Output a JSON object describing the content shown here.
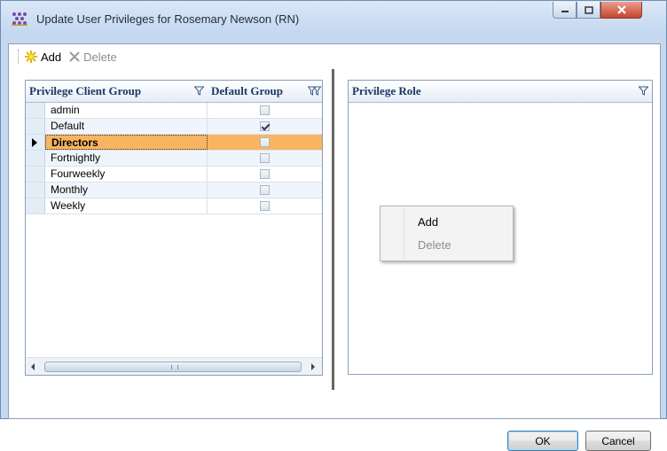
{
  "window": {
    "title": "Update User Privileges for Rosemary Newson (RN)"
  },
  "toolbar": {
    "add_label": "Add",
    "delete_label": "Delete"
  },
  "left_grid": {
    "columns": [
      "Privilege Client Group",
      "Default Group"
    ],
    "rows": [
      {
        "name": "admin",
        "default": false
      },
      {
        "name": "Default",
        "default": true
      },
      {
        "name": "Directors",
        "default": false,
        "selected": true
      },
      {
        "name": "Fortnightly",
        "default": false
      },
      {
        "name": "Fourweekly",
        "default": false
      },
      {
        "name": "Monthly",
        "default": false
      },
      {
        "name": "Weekly",
        "default": false
      }
    ]
  },
  "right_grid": {
    "columns": [
      "Privilege Role"
    ]
  },
  "context_menu": {
    "items": [
      {
        "label": "Add",
        "enabled": true
      },
      {
        "label": "Delete",
        "enabled": false
      }
    ]
  },
  "buttons": {
    "ok": "OK",
    "cancel": "Cancel"
  },
  "colors": {
    "selected_row": "#f9b460",
    "header_text": "#1c3962",
    "accent": "#c5d8ee"
  }
}
